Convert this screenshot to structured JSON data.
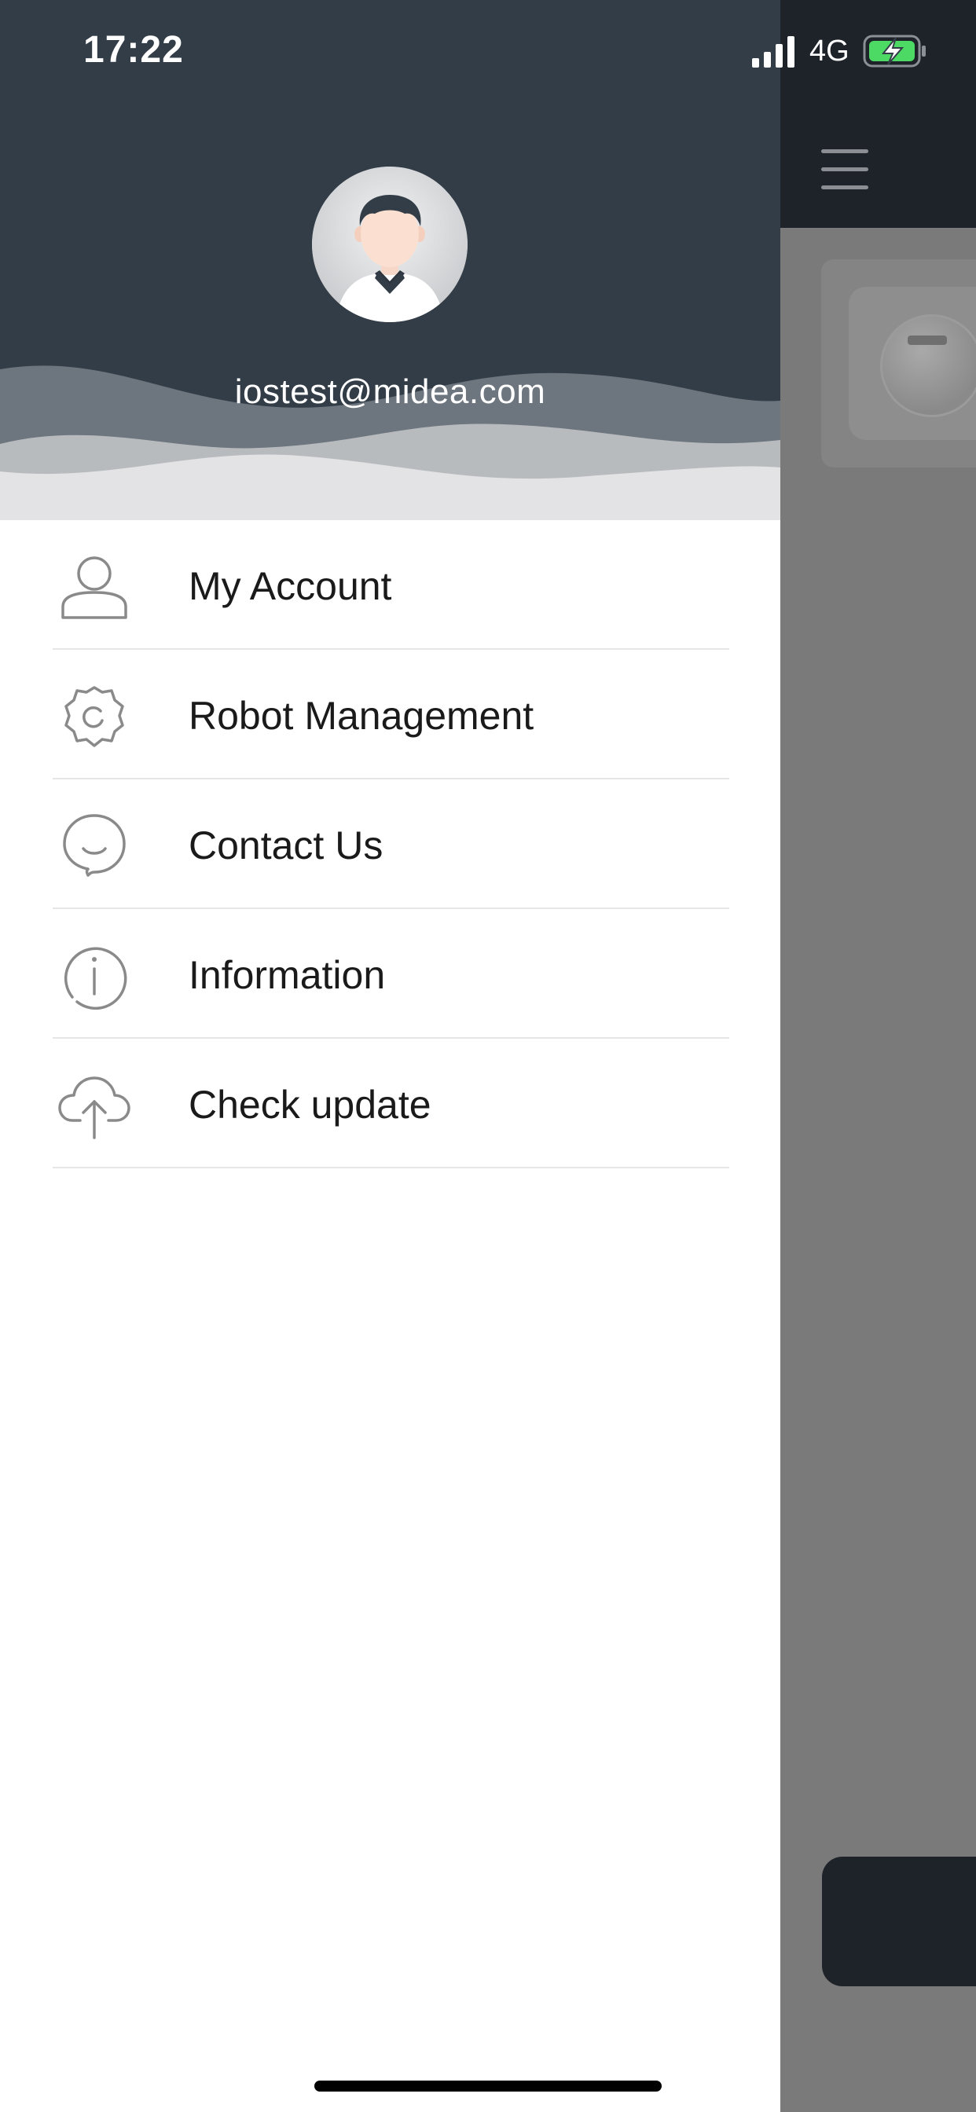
{
  "status_bar": {
    "time": "17:22",
    "network": "4G",
    "signal_icon": "signal-bars-icon",
    "battery_icon": "battery-charging-icon",
    "battery_color": "#4cd964"
  },
  "drawer": {
    "user": {
      "email": "iostest@midea.com",
      "avatar_icon": "user-avatar-icon"
    },
    "menu": [
      {
        "label": "My Account",
        "icon": "person-icon"
      },
      {
        "label": "Robot Management",
        "icon": "gear-icon"
      },
      {
        "label": "Contact Us",
        "icon": "chat-bubble-icon"
      },
      {
        "label": "Information",
        "icon": "info-icon"
      },
      {
        "label": "Check update",
        "icon": "cloud-upload-icon"
      }
    ],
    "header_color": "#333d47"
  },
  "background": {
    "menu_icon": "hamburger-menu-icon"
  }
}
